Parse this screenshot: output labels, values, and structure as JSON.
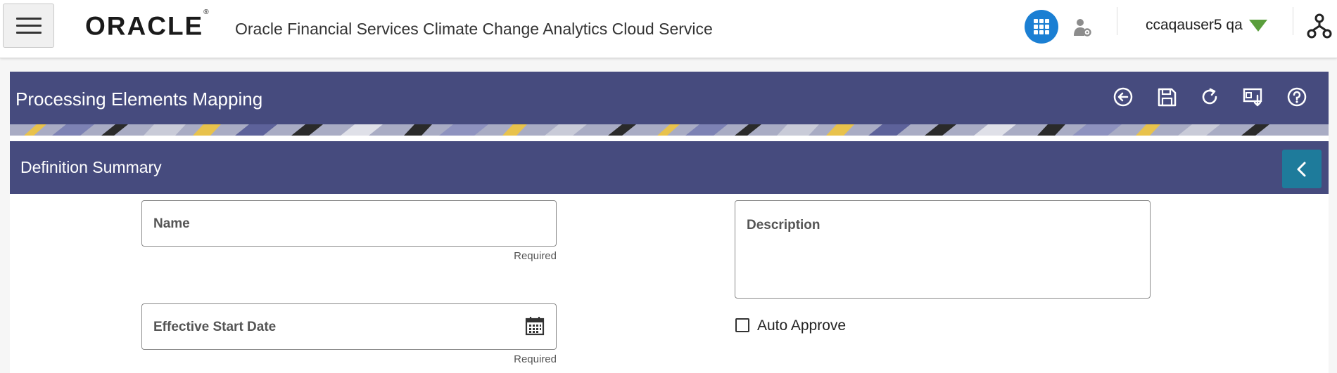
{
  "header": {
    "logo": "ORACLE",
    "app_title": "Oracle Financial Services Climate Change Analytics Cloud Service",
    "username": "ccaqauser5 qa",
    "icons": {
      "menu": "hamburger-menu-icon",
      "apps": "grid-apps-icon",
      "user_settings": "user-gear-icon",
      "user_dropdown": "caret-down-icon",
      "hierarchy": "hierarchy-icon"
    },
    "colors": {
      "apps_button": "#1b7fd3",
      "caret": "#5a9e3c"
    }
  },
  "page": {
    "title": "Processing Elements Mapping",
    "toolbar": [
      "back-icon",
      "save-icon",
      "refresh-icon",
      "export-icon",
      "help-icon"
    ],
    "banner_color": "#464b7e"
  },
  "section": {
    "title": "Definition Summary",
    "collapse_icon": "chevron-left-icon",
    "collapse_color": "#1e7b9b"
  },
  "form": {
    "name": {
      "label": "Name",
      "value": "",
      "hint": "Required"
    },
    "description": {
      "label": "Description",
      "value": ""
    },
    "effective_start_date": {
      "label": "Effective Start Date",
      "value": "",
      "hint": "Required"
    },
    "auto_approve": {
      "label": "Auto Approve",
      "checked": false
    }
  }
}
